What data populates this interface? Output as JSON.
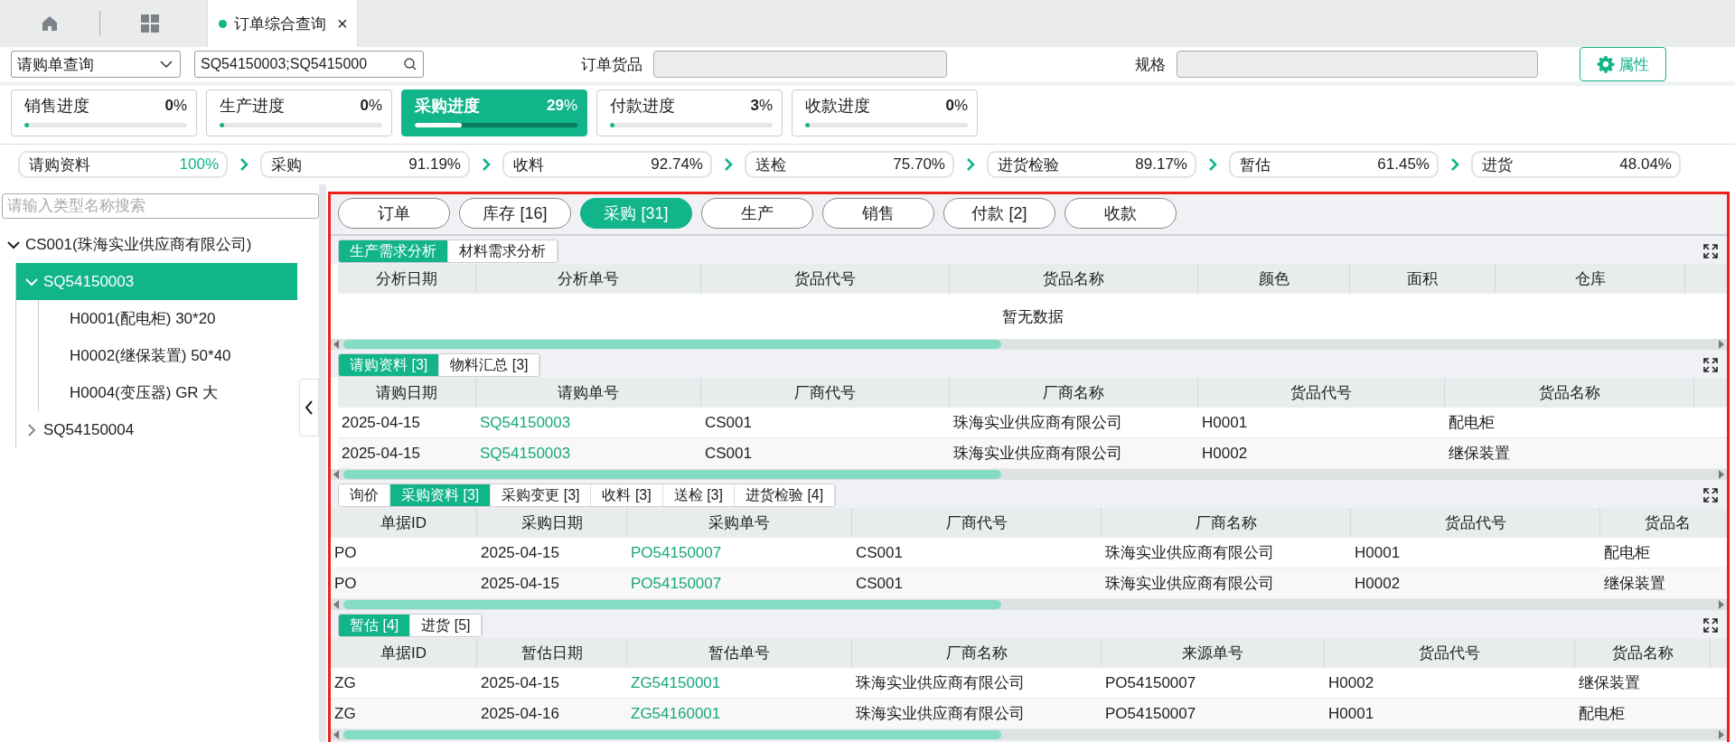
{
  "top_tabs": [
    {
      "kind": "home"
    },
    {
      "kind": "grid"
    },
    {
      "kind": "page",
      "label": "订单综合查询",
      "close": "×"
    }
  ],
  "filters": {
    "query_type": "请购单查询",
    "search_value": "SQ54150003;SQ5415000",
    "goods_label": "订单货品",
    "spec_label": "规格",
    "attr_button": "属性"
  },
  "progress_cards": [
    {
      "label": "销售进度",
      "value": "**0**%",
      "level": 0,
      "selected": false
    },
    {
      "label": "生产进度",
      "value": "**0**%",
      "level": 0,
      "selected": false
    },
    {
      "label": "采购进度",
      "value": "**29**%",
      "level": 0.29,
      "selected": true
    },
    {
      "label": "付款进度",
      "value": "**3**%",
      "level": 0.03,
      "selected": false
    },
    {
      "label": "收款进度",
      "value": "**0**%",
      "level": 0,
      "selected": false
    }
  ],
  "flow": [
    {
      "label": "请购资料",
      "value": "100%",
      "complete": true
    },
    {
      "label": "采购",
      "value": "91.19%",
      "complete": false
    },
    {
      "label": "收料",
      "value": "92.74%",
      "complete": false
    },
    {
      "label": "送检",
      "value": "75.70%",
      "complete": false
    },
    {
      "label": "进货检验",
      "value": "89.17%",
      "complete": false
    },
    {
      "label": "暂估",
      "value": "61.45%",
      "complete": false
    },
    {
      "label": "进货",
      "value": "48.04%",
      "complete": false
    }
  ],
  "tree": {
    "search_placeholder": "请输入类型名称搜索",
    "items": [
      {
        "label": "CS001(珠海实业供应商有限公司)",
        "expanded": true,
        "selected": false,
        "children": [
          {
            "label": "SQ54150003",
            "expanded": true,
            "selected": true,
            "children": [
              {
                "label": "H0001(配电柜) 30*20",
                "selected": false
              },
              {
                "label": "H0002(继保装置) 50*40",
                "selected": false
              },
              {
                "label": "H0004(变压器) GR 大",
                "selected": false
              }
            ]
          },
          {
            "label": "SQ54150004",
            "expanded": false,
            "selected": false
          }
        ]
      }
    ]
  },
  "module_tabs": [
    {
      "label": "订单",
      "selected": false
    },
    {
      "label": "库存 [16]",
      "selected": false
    },
    {
      "label": "采购 [31]",
      "selected": true
    },
    {
      "label": "生产",
      "selected": false
    },
    {
      "label": "销售",
      "selected": false
    },
    {
      "label": "付款 [2]",
      "selected": false
    },
    {
      "label": "收款",
      "selected": false
    }
  ],
  "sections": [
    {
      "tabs": [
        {
          "label": "生产需求分析",
          "selected": true
        },
        {
          "label": "材料需求分析",
          "selected": false
        }
      ],
      "columns": [
        {
          "label": "分析日期"
        },
        {
          "label": "分析单号"
        },
        {
          "label": "货品代号"
        },
        {
          "label": "货品名称"
        },
        {
          "label": "颜色"
        },
        {
          "label": "面积"
        },
        {
          "label": "仓库"
        }
      ],
      "empty_text": "暂无数据"
    },
    {
      "tabs": [
        {
          "label": "请购资料 [3]",
          "selected": true
        },
        {
          "label": "物料汇总 [3]",
          "selected": false
        }
      ],
      "columns": [
        {
          "label": "请购日期"
        },
        {
          "label": "请购单号",
          "link": true
        },
        {
          "label": "厂商代号"
        },
        {
          "label": "厂商名称"
        },
        {
          "label": "货品代号"
        },
        {
          "label": "货品名称"
        }
      ],
      "rows": [
        [
          "2025-04-15",
          "SQ54150003",
          "CS001",
          "珠海实业供应商有限公司",
          "H0001",
          "配电柜"
        ],
        [
          "2025-04-15",
          "SQ54150003",
          "CS001",
          "珠海实业供应商有限公司",
          "H0002",
          "继保装置"
        ]
      ]
    },
    {
      "tabs": [
        {
          "label": "询价",
          "selected": false
        },
        {
          "label": "采购资料 [3]",
          "selected": true
        },
        {
          "label": "采购变更 [3]",
          "selected": false
        },
        {
          "label": "收料 [3]",
          "selected": false
        },
        {
          "label": "送检 [3]",
          "selected": false
        },
        {
          "label": "进货检验 [4]",
          "selected": false
        }
      ],
      "columns": [
        {
          "label": "单据ID"
        },
        {
          "label": "采购日期"
        },
        {
          "label": "采购单号",
          "link": true
        },
        {
          "label": "厂商代号"
        },
        {
          "label": "厂商名称"
        },
        {
          "label": "货品代号"
        },
        {
          "label": "货品名"
        }
      ],
      "rows": [
        [
          "PO",
          "2025-04-15",
          "PO54150007",
          "CS001",
          "珠海实业供应商有限公司",
          "H0001",
          "配电柜"
        ],
        [
          "PO",
          "2025-04-15",
          "PO54150007",
          "CS001",
          "珠海实业供应商有限公司",
          "H0002",
          "继保装置"
        ]
      ]
    },
    {
      "tabs": [
        {
          "label": "暂估 [4]",
          "selected": true
        },
        {
          "label": "进货 [5]",
          "selected": false
        }
      ],
      "columns": [
        {
          "label": "单据ID"
        },
        {
          "label": "暂估日期"
        },
        {
          "label": "暂估单号",
          "link": true
        },
        {
          "label": "厂商名称"
        },
        {
          "label": "来源单号"
        },
        {
          "label": "货品代号"
        },
        {
          "label": "货品名称"
        }
      ],
      "rows": [
        [
          "ZG",
          "2025-04-15",
          "ZG54150001",
          "珠海实业供应商有限公司",
          "PO54150007",
          "H0002",
          "继保装置"
        ],
        [
          "ZG",
          "2025-04-16",
          "ZG54160001",
          "珠海实业供应商有限公司",
          "PO54150007",
          "H0001",
          "配电柜"
        ]
      ]
    }
  ]
}
